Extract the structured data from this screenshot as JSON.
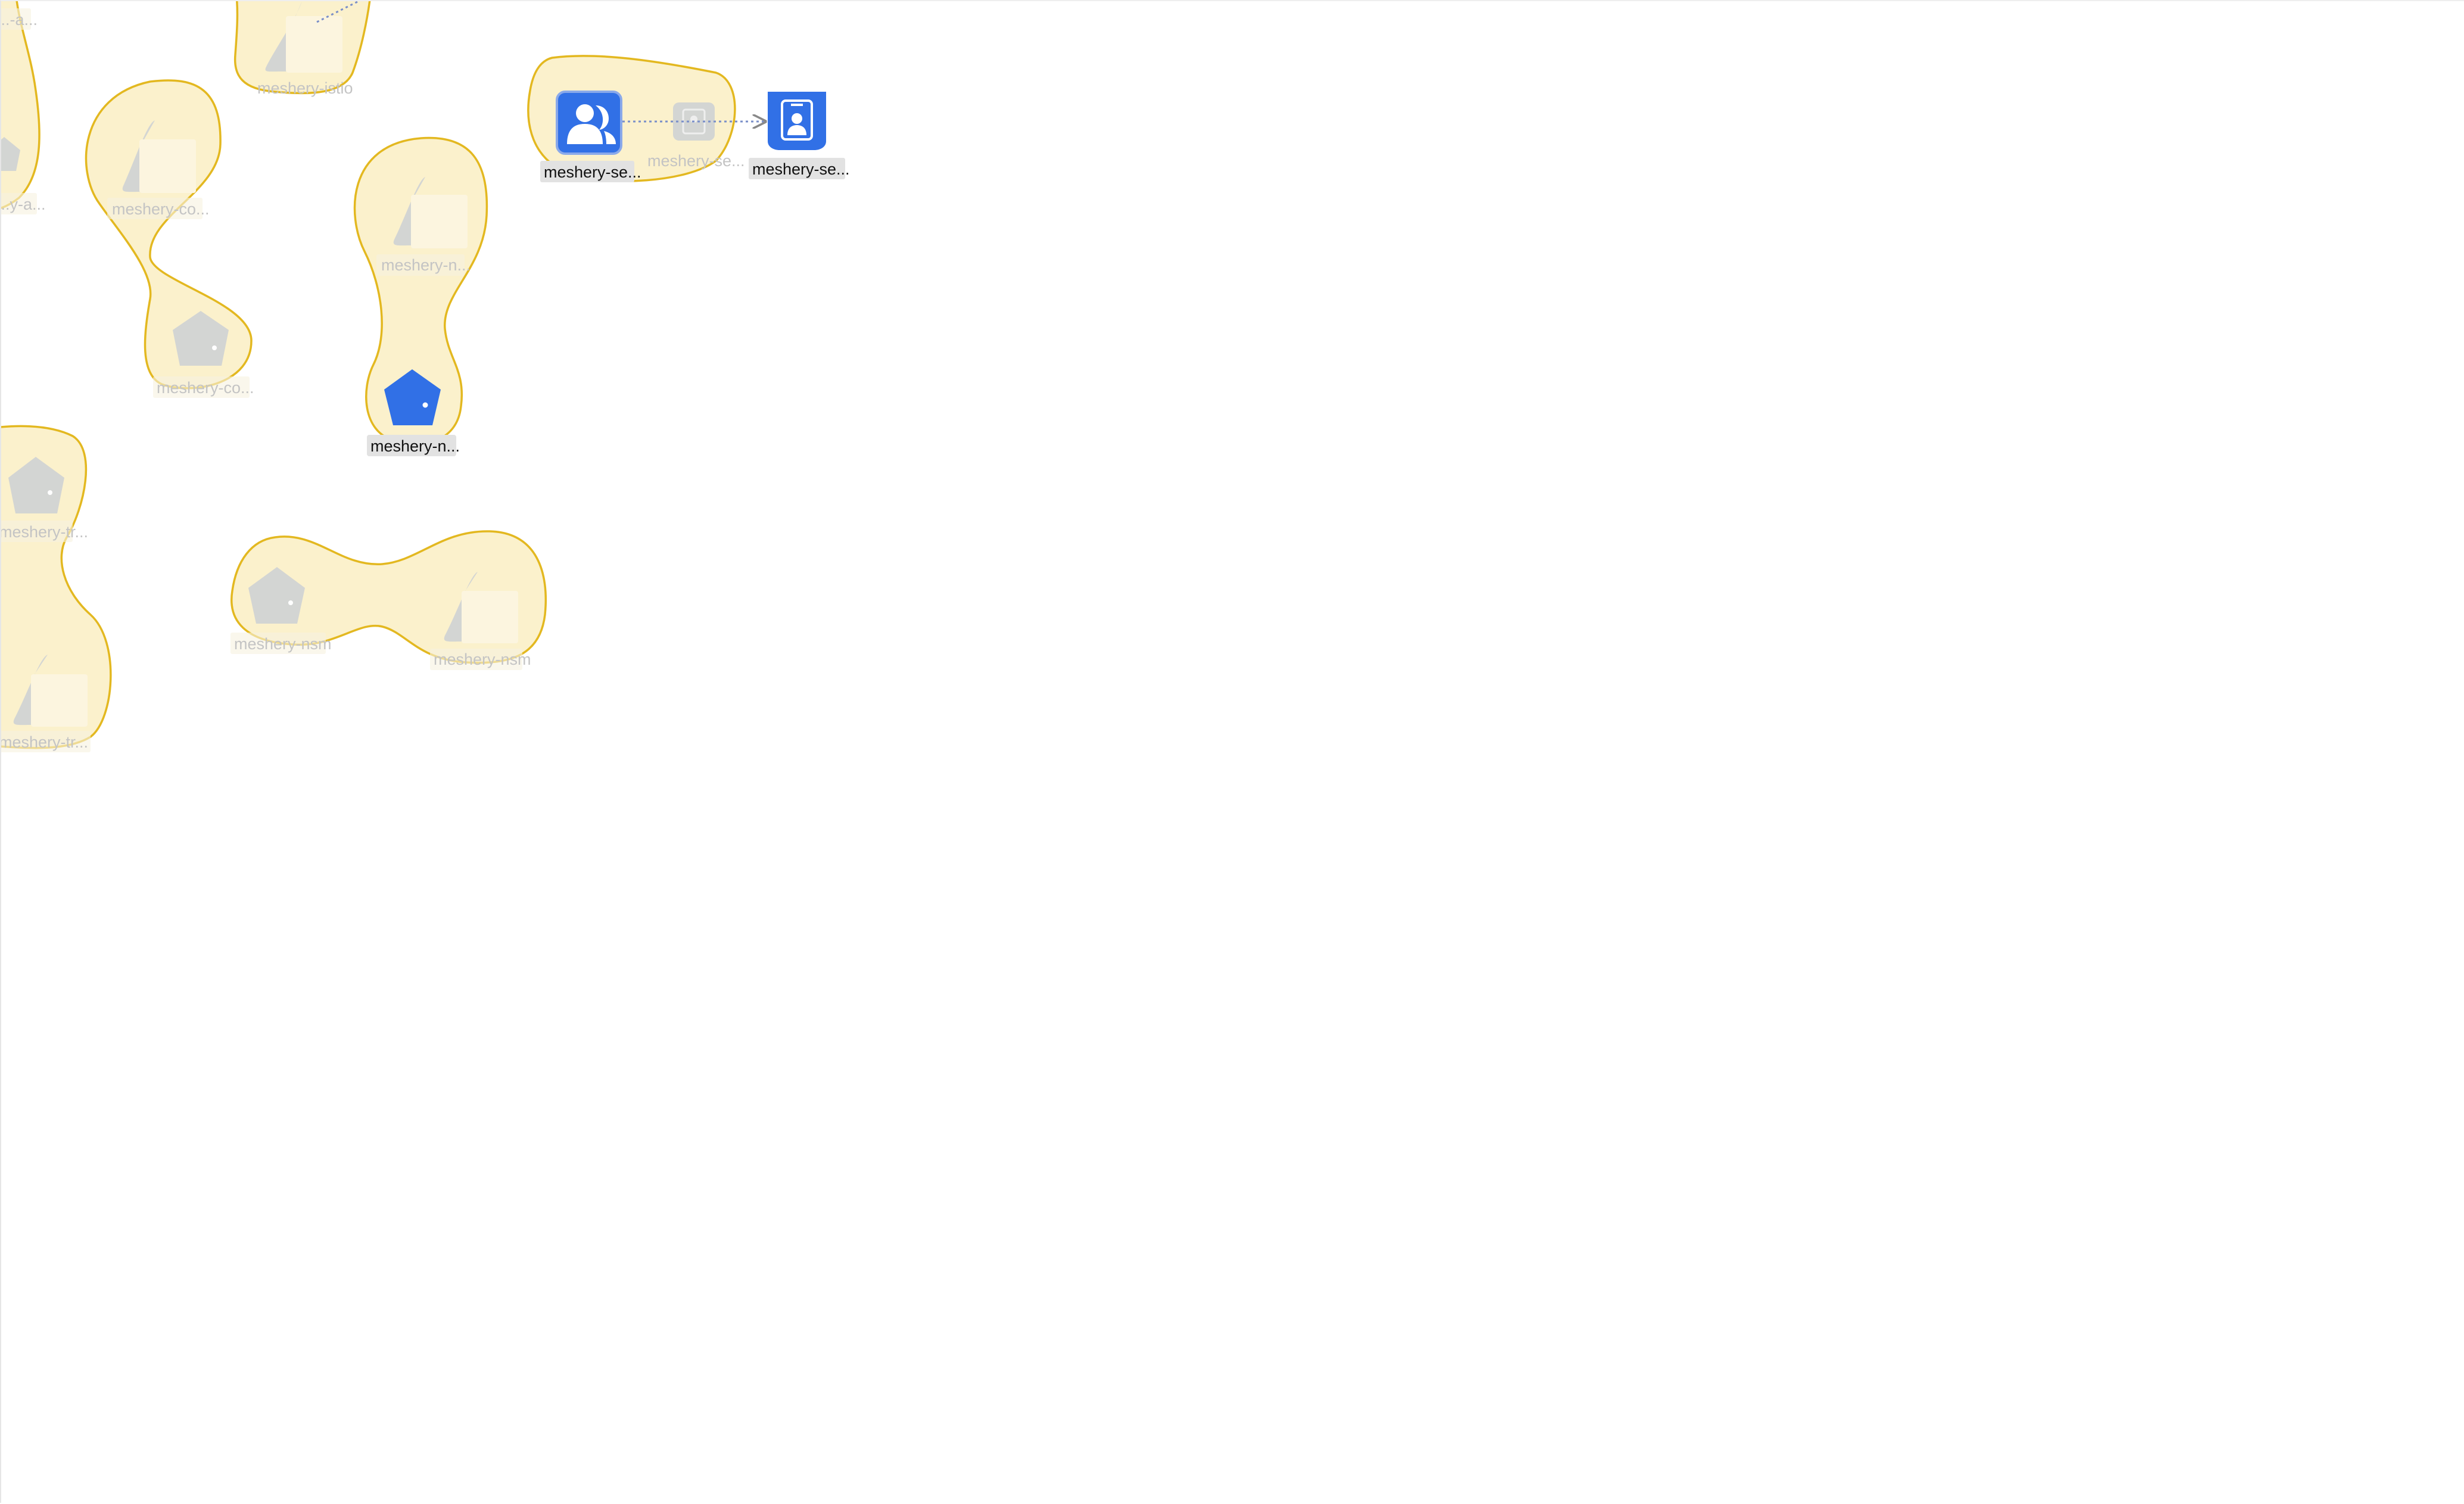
{
  "colors": {
    "group_fill": "#fbf1cc",
    "group_stroke": "#e3b820",
    "active_node": "#3170e6",
    "dim_node": "#d3d5d3",
    "label_bg": "#e6e6e6",
    "edge": "#7a8fc9"
  },
  "groups": [
    {
      "name": "meshery-a",
      "labels": [
        "...-a...",
        "...y-a..."
      ]
    },
    {
      "name": "meshery-istio",
      "labels": [
        "meshery-istio"
      ]
    },
    {
      "name": "meshery-co",
      "labels": [
        "meshery-co...",
        "meshery-co..."
      ]
    },
    {
      "name": "meshery-n",
      "labels": [
        "meshery-n...",
        "meshery-n..."
      ]
    },
    {
      "name": "meshery-se",
      "labels": [
        "meshery-se...",
        "meshery-se..."
      ]
    },
    {
      "name": "meshery-tr",
      "labels": [
        "meshery-tr...",
        "meshery-tr..."
      ]
    },
    {
      "name": "meshery-nsm",
      "labels": [
        "meshery-nsm",
        "meshery-nsm"
      ]
    }
  ],
  "standalone_nodes": [
    {
      "name": "meshery-se-role",
      "label": "meshery-se...",
      "icon": "id-badge-icon"
    }
  ],
  "icons": {
    "deployment": "deployment-triangle-icon",
    "service": "service-pentagon-icon",
    "serviceaccount": "users-icon",
    "rolebinding": "id-card-icon",
    "role": "id-badge-icon"
  }
}
